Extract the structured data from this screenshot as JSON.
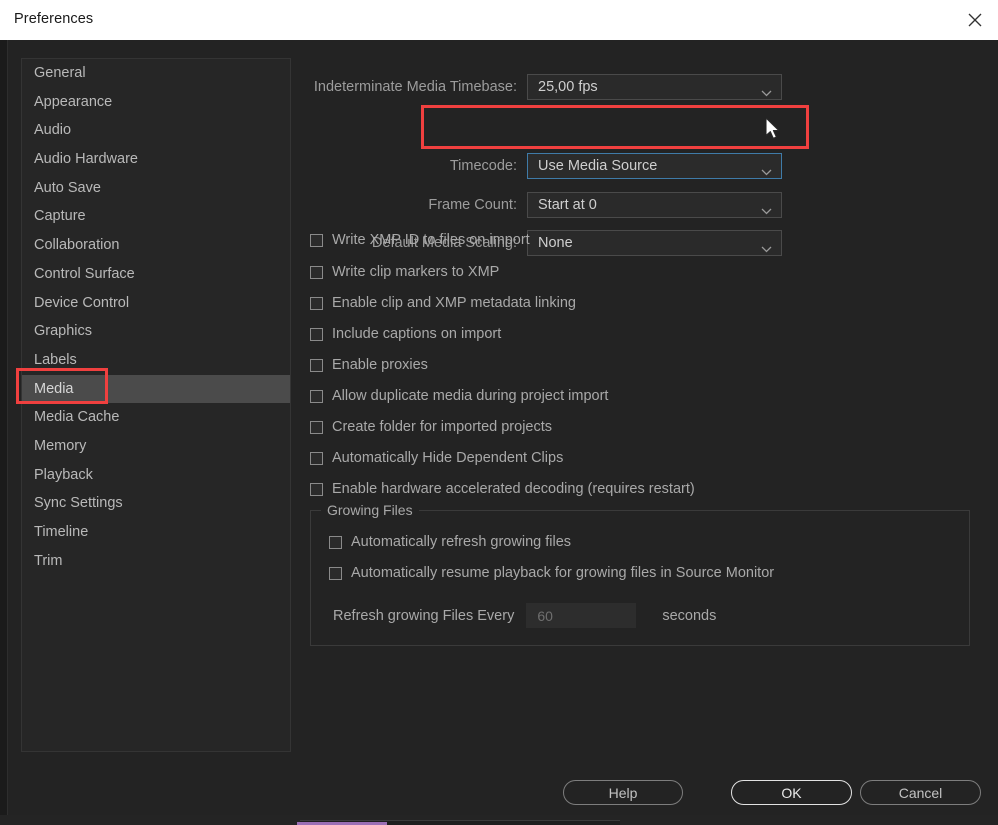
{
  "window": {
    "title": "Preferences",
    "close_icon": "close-icon"
  },
  "sidebar": {
    "items": [
      {
        "label": "General",
        "selected": false
      },
      {
        "label": "Appearance",
        "selected": false
      },
      {
        "label": "Audio",
        "selected": false
      },
      {
        "label": "Audio Hardware",
        "selected": false
      },
      {
        "label": "Auto Save",
        "selected": false
      },
      {
        "label": "Capture",
        "selected": false
      },
      {
        "label": "Collaboration",
        "selected": false
      },
      {
        "label": "Control Surface",
        "selected": false
      },
      {
        "label": "Device Control",
        "selected": false
      },
      {
        "label": "Graphics",
        "selected": false
      },
      {
        "label": "Labels",
        "selected": false
      },
      {
        "label": "Media",
        "selected": true
      },
      {
        "label": "Media Cache",
        "selected": false
      },
      {
        "label": "Memory",
        "selected": false
      },
      {
        "label": "Playback",
        "selected": false
      },
      {
        "label": "Sync Settings",
        "selected": false
      },
      {
        "label": "Timeline",
        "selected": false
      },
      {
        "label": "Trim",
        "selected": false
      }
    ]
  },
  "main": {
    "fields": [
      {
        "label": "Indeterminate Media Timebase:",
        "value": "25,00 fps",
        "focused": false
      },
      {
        "label": "Timecode:",
        "value": "Use Media Source",
        "focused": true
      },
      {
        "label": "Frame Count:",
        "value": "Start at 0",
        "focused": false
      },
      {
        "label": "Default Media Scaling:",
        "value": "None",
        "focused": false
      }
    ],
    "checkboxes": [
      {
        "label": "Write XMP ID to files on import",
        "checked": false
      },
      {
        "label": "Write clip markers to XMP",
        "checked": false
      },
      {
        "label": "Enable clip and XMP metadata linking",
        "checked": false
      },
      {
        "label": "Include captions on import",
        "checked": false
      },
      {
        "label": "Enable proxies",
        "checked": false
      },
      {
        "label": "Allow duplicate media during project import",
        "checked": false
      },
      {
        "label": "Create folder for imported projects",
        "checked": false
      },
      {
        "label": "Automatically Hide Dependent Clips",
        "checked": false
      },
      {
        "label": "Enable hardware accelerated decoding (requires restart)",
        "checked": false
      }
    ],
    "growing_files": {
      "title": "Growing Files",
      "checkboxes": [
        {
          "label": "Automatically refresh growing files",
          "checked": false
        },
        {
          "label": "Automatically resume playback for growing files in Source Monitor",
          "checked": false
        }
      ],
      "refresh_label": "Refresh growing Files Every",
      "refresh_value": "60",
      "refresh_unit": "seconds"
    }
  },
  "footer": {
    "help_label": "Help",
    "ok_label": "OK",
    "cancel_label": "Cancel"
  },
  "colors": {
    "annotation": "#f0403f",
    "focus_border": "#3f7ba8",
    "selection": "#4b4b4b",
    "titlebar_bg": "#ffffff",
    "dialog_bg": "#232323"
  }
}
